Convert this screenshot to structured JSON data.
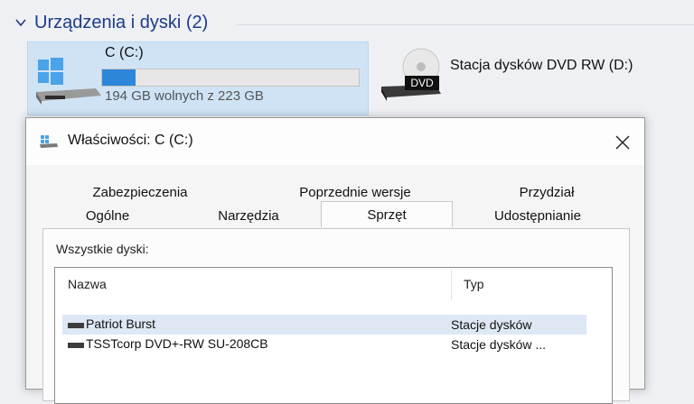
{
  "explorer": {
    "group_title": "Urządzenia i dyski (2)",
    "drive_c": {
      "name": "C (C:)",
      "free_text": "194 GB wolnych z 223 GB",
      "used_fraction": 0.13
    },
    "dvd": {
      "name": "Stacja dysków DVD RW (D:)",
      "badge": "DVD"
    }
  },
  "dialog": {
    "title": "Właściwości: C (C:)",
    "tabs_row1": [
      "Zabezpieczenia",
      "Poprzednie wersje",
      "Przydział"
    ],
    "tabs_row2": [
      "Ogólne",
      "Narzędzia",
      "Sprzęt",
      "Udostępnianie"
    ],
    "active_tab": "Sprzęt",
    "all_disks_label": "Wszystkie dyski:",
    "columns": {
      "name": "Nazwa",
      "type": "Typ"
    },
    "rows": [
      {
        "name": "Patriot Burst",
        "type": "Stacje dysków"
      },
      {
        "name": "TSSTcorp DVD+-RW SU-208CB",
        "type": "Stacje dysków ..."
      }
    ]
  },
  "colors": {
    "accent": "#2d86d9",
    "group_title": "#1e3a8a",
    "selection": "#dde8f4"
  }
}
